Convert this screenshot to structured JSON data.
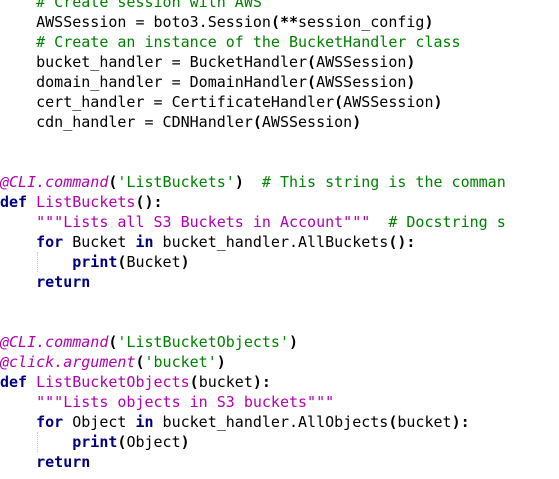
{
  "editor": {
    "colors": {
      "background": "#ffffff",
      "comment": "#008000",
      "keyword": "#000080",
      "decorator": "#b200b2",
      "string": "#008000",
      "docstring": "#b200b2",
      "function_name": "#b200b2",
      "text": "#000000"
    },
    "lines": [
      [
        {
          "t": "    "
        },
        {
          "t": "# Create session with AWS",
          "k": "comment"
        }
      ],
      [
        {
          "t": "    AWSSession = boto3.Session"
        },
        {
          "t": "(**",
          "k": "punct"
        },
        {
          "t": "session_config"
        },
        {
          "t": ")",
          "k": "punct"
        }
      ],
      [
        {
          "t": "    "
        },
        {
          "t": "# Create an instance of the BucketHandler class",
          "k": "comment"
        }
      ],
      [
        {
          "t": "    bucket_handler = BucketHandler"
        },
        {
          "t": "(",
          "k": "punct"
        },
        {
          "t": "AWSSession"
        },
        {
          "t": ")",
          "k": "punct"
        }
      ],
      [
        {
          "t": "    domain_handler = DomainHandler"
        },
        {
          "t": "(",
          "k": "punct"
        },
        {
          "t": "AWSSession"
        },
        {
          "t": ")",
          "k": "punct"
        }
      ],
      [
        {
          "t": "    cert_handler = CertificateHandler"
        },
        {
          "t": "(",
          "k": "punct"
        },
        {
          "t": "AWSSession"
        },
        {
          "t": ")",
          "k": "punct"
        }
      ],
      [
        {
          "t": "    cdn_handler = CDNHandler"
        },
        {
          "t": "(",
          "k": "punct"
        },
        {
          "t": "AWSSession"
        },
        {
          "t": ")",
          "k": "punct"
        }
      ],
      [],
      [],
      [
        {
          "t": "@CLI.command",
          "k": "deco"
        },
        {
          "t": "(",
          "k": "punct"
        },
        {
          "t": "'ListBuckets'",
          "k": "str"
        },
        {
          "t": ")",
          "k": "punct"
        },
        {
          "t": "  "
        },
        {
          "t": "# This string is the comman",
          "k": "comment"
        }
      ],
      [
        {
          "t": "def",
          "k": "keyword"
        },
        {
          "t": " "
        },
        {
          "t": "ListBuckets",
          "k": "func"
        },
        {
          "t": "():",
          "k": "punct"
        }
      ],
      [
        {
          "t": "    "
        },
        {
          "t": "\"\"\"Lists all S3 Buckets in Account\"\"\"",
          "k": "doc"
        },
        {
          "t": "  "
        },
        {
          "t": "# Docstring s",
          "k": "comment"
        }
      ],
      [
        {
          "t": "    "
        },
        {
          "t": "for",
          "k": "keyword"
        },
        {
          "t": " Bucket "
        },
        {
          "t": "in",
          "k": "keyword"
        },
        {
          "t": " bucket_handler.AllBuckets"
        },
        {
          "t": "():",
          "k": "punct"
        }
      ],
      [
        {
          "t": "        "
        },
        {
          "t": "print",
          "k": "keyword"
        },
        {
          "t": "(",
          "k": "punct"
        },
        {
          "t": "Bucket"
        },
        {
          "t": ")",
          "k": "punct"
        }
      ],
      [
        {
          "t": "    "
        },
        {
          "t": "return",
          "k": "keyword"
        }
      ],
      [],
      [],
      [
        {
          "t": "@CLI.command",
          "k": "deco"
        },
        {
          "t": "(",
          "k": "punct"
        },
        {
          "t": "'ListBucketObjects'",
          "k": "str"
        },
        {
          "t": ")",
          "k": "punct"
        }
      ],
      [
        {
          "t": "@click.argument",
          "k": "deco"
        },
        {
          "t": "(",
          "k": "punct"
        },
        {
          "t": "'bucket'",
          "k": "str"
        },
        {
          "t": ")",
          "k": "punct"
        }
      ],
      [
        {
          "t": "def",
          "k": "keyword"
        },
        {
          "t": " "
        },
        {
          "t": "ListBucketObjects",
          "k": "func"
        },
        {
          "t": "(",
          "k": "punct"
        },
        {
          "t": "bucket"
        },
        {
          "t": "):",
          "k": "punct"
        }
      ],
      [
        {
          "t": "    "
        },
        {
          "t": "\"\"\"Lists objects in S3 buckets\"\"\"",
          "k": "doc"
        }
      ],
      [
        {
          "t": "    "
        },
        {
          "t": "for",
          "k": "keyword"
        },
        {
          "t": " Object "
        },
        {
          "t": "in",
          "k": "keyword"
        },
        {
          "t": " bucket_handler.AllObjects"
        },
        {
          "t": "(",
          "k": "punct"
        },
        {
          "t": "bucket"
        },
        {
          "t": "):",
          "k": "punct"
        }
      ],
      [
        {
          "t": "        "
        },
        {
          "t": "print",
          "k": "keyword"
        },
        {
          "t": "(",
          "k": "punct"
        },
        {
          "t": "Object"
        },
        {
          "t": ")",
          "k": "punct"
        }
      ],
      [
        {
          "t": "    "
        },
        {
          "t": "return",
          "k": "keyword"
        }
      ]
    ]
  }
}
